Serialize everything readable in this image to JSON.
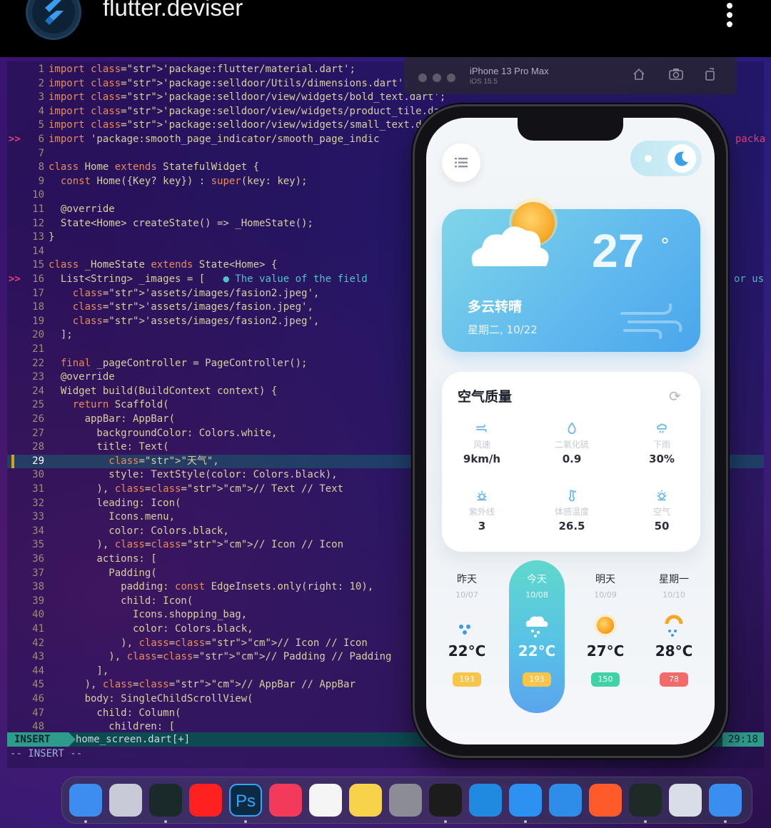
{
  "post": {
    "username": "flutter.deviser"
  },
  "editor": {
    "lines": [
      {
        "n": "1",
        "code": "import 'package:flutter/material.dart';"
      },
      {
        "n": "2",
        "code": "import 'package:selldoor/Utils/dimensions.dart';"
      },
      {
        "n": "3",
        "code": "import 'package:selldoor/view/widgets/bold_text.dart';"
      },
      {
        "n": "4",
        "code": "import 'package:selldoor/view/widgets/product_tile.dart';"
      },
      {
        "n": "5",
        "code": "import 'package:selldoor/view/widgets/small_text.dart';"
      },
      {
        "n": "6",
        "code": "import 'package:smooth_page_indicator/smooth_page_indic",
        "mark": ">>",
        "overflow": "packa"
      },
      {
        "n": "7",
        "code": ""
      },
      {
        "n": "8",
        "code": "class Home extends StatefulWidget {"
      },
      {
        "n": "9",
        "code": "  const Home({Key? key}) : super(key: key);"
      },
      {
        "n": "10",
        "code": ""
      },
      {
        "n": "11",
        "code": "  @override"
      },
      {
        "n": "12",
        "code": "  State<Home> createState() => _HomeState();"
      },
      {
        "n": "13",
        "code": "}"
      },
      {
        "n": "14",
        "code": ""
      },
      {
        "n": "15",
        "code": "class _HomeState extends State<Home> {"
      },
      {
        "n": "16",
        "code": "  List<String> _images = [   ● The value of the field",
        "mark": ">>",
        "hint_right": "or us"
      },
      {
        "n": "17",
        "code": "    'assets/images/fasion2.jpeg',"
      },
      {
        "n": "18",
        "code": "    'assets/images/fasion.jpeg',"
      },
      {
        "n": "19",
        "code": "    'assets/images/fasion2.jpeg',"
      },
      {
        "n": "20",
        "code": "  ];"
      },
      {
        "n": "21",
        "code": ""
      },
      {
        "n": "22",
        "code": "  final _pageController = PageController();"
      },
      {
        "n": "23",
        "code": "  @override"
      },
      {
        "n": "24",
        "code": "  Widget build(BuildContext context) {"
      },
      {
        "n": "25",
        "code": "    return Scaffold("
      },
      {
        "n": "26",
        "code": "      appBar: AppBar("
      },
      {
        "n": "27",
        "code": "        backgroundColor: Colors.white,"
      },
      {
        "n": "28",
        "code": "        title: Text("
      },
      {
        "n": "29",
        "code": "          \"天气\","
      },
      {
        "n": "30",
        "code": "          style: TextStyle(color: Colors.black),"
      },
      {
        "n": "31",
        "code": "        ), // Text // Text"
      },
      {
        "n": "32",
        "code": "        leading: Icon("
      },
      {
        "n": "33",
        "code": "          Icons.menu,"
      },
      {
        "n": "34",
        "code": "          color: Colors.black,"
      },
      {
        "n": "35",
        "code": "        ), // Icon // Icon"
      },
      {
        "n": "36",
        "code": "        actions: ["
      },
      {
        "n": "37",
        "code": "          Padding("
      },
      {
        "n": "38",
        "code": "            padding: const EdgeInsets.only(right: 10),"
      },
      {
        "n": "39",
        "code": "            child: Icon("
      },
      {
        "n": "40",
        "code": "              Icons.shopping_bag,"
      },
      {
        "n": "41",
        "code": "              color: Colors.black,"
      },
      {
        "n": "42",
        "code": "            ), // Icon // Icon"
      },
      {
        "n": "43",
        "code": "          ), // Padding // Padding"
      },
      {
        "n": "44",
        "code": "        ],"
      },
      {
        "n": "45",
        "code": "      ), // AppBar // AppBar"
      },
      {
        "n": "46",
        "code": "      body: SingleChildScrollView("
      },
      {
        "n": "47",
        "code": "        child: Column("
      },
      {
        "n": "48",
        "code": "          children: ["
      }
    ],
    "current_line": "29",
    "status": {
      "mode": "INSERT",
      "file": "home_screen.dart[+]",
      "position": "29:18"
    },
    "cmdline": "-- INSERT --"
  },
  "simulator": {
    "device": "iPhone 13 Pro Max",
    "os": "iOS 15.5"
  },
  "app": {
    "temperature": "27",
    "temperature_unit": "°",
    "condition": "多云转晴",
    "date": "星期二, 10/22",
    "air_quality": {
      "title": "空气质量",
      "items": [
        {
          "label": "风速",
          "value": "9km/h",
          "icon": "wind-icon"
        },
        {
          "label": "二氧化硫",
          "value": "0.9",
          "icon": "drop-icon"
        },
        {
          "label": "下雨",
          "value": "30%",
          "icon": "rain-icon"
        },
        {
          "label": "紫外线",
          "value": "3",
          "icon": "uv-sun-icon"
        },
        {
          "label": "体感温度",
          "value": "26.5",
          "icon": "thermometer-icon"
        },
        {
          "label": "空气",
          "value": "50",
          "icon": "sun-icon"
        }
      ]
    },
    "forecast": [
      {
        "day": "昨天",
        "date": "10/07",
        "temp": "22°C",
        "aqi": "193",
        "aqi_color": "#f6c54a",
        "icon": "rain-cloud-icon"
      },
      {
        "day": "今天",
        "date": "10/08",
        "temp": "22°C",
        "aqi": "193",
        "aqi_color": "#f6c54a",
        "icon": "snow-cloud-icon"
      },
      {
        "day": "明天",
        "date": "10/09",
        "temp": "27°C",
        "aqi": "150",
        "aqi_color": "#3fd2a8",
        "icon": "sun-icon"
      },
      {
        "day": "星期一",
        "date": "10/10",
        "temp": "28°C",
        "aqi": "78",
        "aqi_color": "#f26a6a",
        "icon": "sun-rain-icon"
      }
    ]
  },
  "dock": [
    {
      "name": "finder-icon",
      "color": "#3d8cf0"
    },
    {
      "name": "launchpad-icon",
      "color": "#c8cad8"
    },
    {
      "name": "dart-devtools-icon",
      "color": "#1a2a2a"
    },
    {
      "name": "youtube-icon",
      "color": "#ff2020"
    },
    {
      "name": "photoshop-icon",
      "color": "#0c2a44"
    },
    {
      "name": "music-icon",
      "color": "#f43a5a"
    },
    {
      "name": "photos-icon",
      "color": "#f5f5f5"
    },
    {
      "name": "notes-icon",
      "color": "#f7d24a"
    },
    {
      "name": "system-settings-icon",
      "color": "#8c8c94"
    },
    {
      "name": "terminal-icon",
      "color": "#1c1c1c"
    },
    {
      "name": "vscode-icon",
      "color": "#1f8ae0"
    },
    {
      "name": "safari-icon",
      "color": "#2b92f2"
    },
    {
      "name": "browser-icon",
      "color": "#2d8de8"
    },
    {
      "name": "brave-icon",
      "color": "#ff5a2a"
    },
    {
      "name": "activity-monitor-icon",
      "color": "#1d2a26"
    },
    {
      "name": "preview-icon",
      "color": "#d8dde8"
    },
    {
      "name": "xcode-icon",
      "color": "#3a8ef0"
    }
  ]
}
